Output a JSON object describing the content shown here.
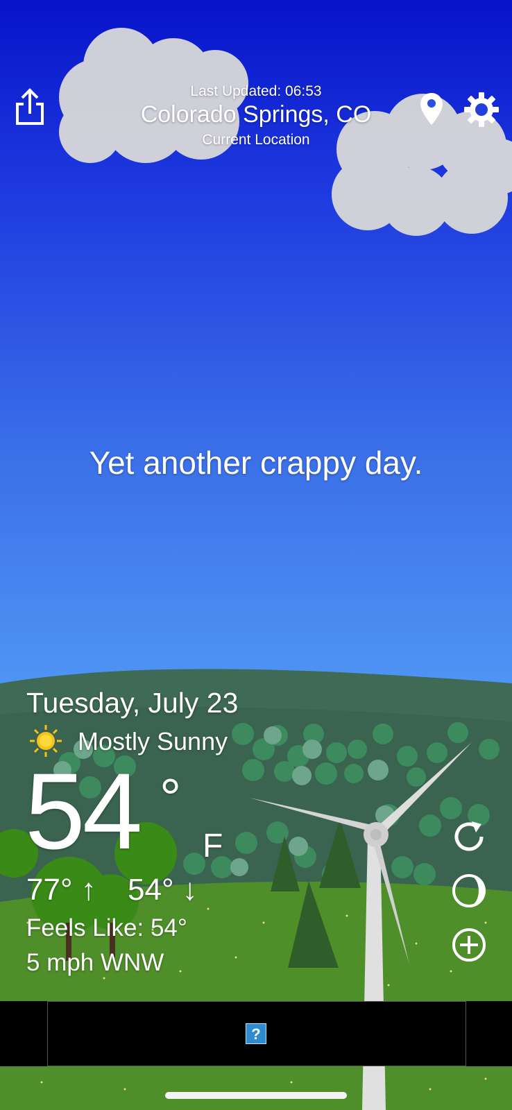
{
  "header": {
    "last_updated": "Last Updated: 06:53",
    "city": "Colorado Springs, CO",
    "location_label": "Current Location"
  },
  "tagline": "Yet another crappy day.",
  "weather": {
    "date": "Tuesday, July 23",
    "condition": "Mostly Sunny",
    "condition_icon": "sun-icon",
    "temperature": "54",
    "degree_symbol": "°",
    "unit": "F",
    "high": "77° ↑",
    "low": "54° ↓",
    "feels_like": "Feels Like: 54°",
    "wind": "5 mph WNW"
  },
  "toolbar": {
    "share_icon": "share-icon",
    "location_icon": "map-pin-icon",
    "settings_icon": "gear-icon"
  },
  "side_buttons": [
    "refresh-icon",
    "moon-icon",
    "add-icon"
  ],
  "ad": {
    "placeholder_glyph": "?"
  },
  "colors": {
    "sky_top": "#0713c9",
    "sky_bottom": "#63aefc",
    "hill_dark": "#3d6b55",
    "grass": "#4f8f2a",
    "ad_bar": "#000000"
  }
}
